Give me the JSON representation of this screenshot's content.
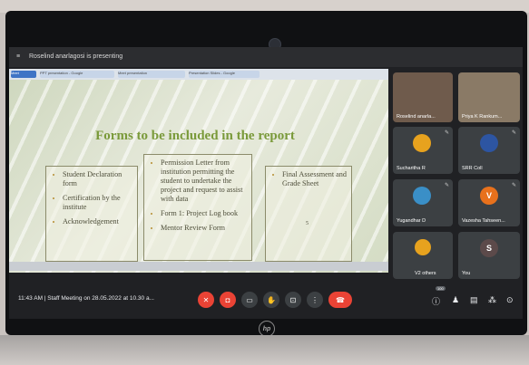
{
  "topbar": {
    "presenting_text": "Roselind anarlagosi is presenting"
  },
  "browser_tabs": [
    "Meet",
    "PPT presentation - Google",
    "Meet presentation",
    "Presentation Slides - Google"
  ],
  "slide": {
    "title": "Forms to be included in the report",
    "col1": [
      "Student Declaration form",
      "Certification by the institute",
      "Acknowledgement"
    ],
    "col2": [
      "Permission Letter from institution permitting the student to undertake the project and request to assist with data",
      "Form 1: Project Log book",
      "Mentor Review Form"
    ],
    "col3": [
      "Final Assessment and Grade Sheet"
    ],
    "box3_number": "5"
  },
  "participants": [
    {
      "name": "Roselind anarla...",
      "color": "#7b6a5a"
    },
    {
      "name": "Priya K Rankum...",
      "color": "#8a7060"
    },
    {
      "name": "Sucharitha R",
      "color": "#e7a21e",
      "initial": ""
    },
    {
      "name": "SRR Coll",
      "color": "#2d55a2",
      "initial": ""
    },
    {
      "name": "Yugandhar D",
      "color": "#3a8fc7",
      "initial": ""
    },
    {
      "name": "Vazesha Tahseen...",
      "color": "#e8711c",
      "initial": "V"
    },
    {
      "name": "V2 others",
      "color": "#e7a21e",
      "initial": ""
    },
    {
      "name": "You",
      "color": "#5c4a4a",
      "initial": "S"
    }
  ],
  "controls": {
    "time_meeting": "11:43 AM  |  Staff Meeting on 28.05.2022 at 10.30 a...",
    "participant_count": "100",
    "colors": {
      "red": "#ea4335",
      "dark": "#3c4043"
    }
  },
  "brand": "hp"
}
